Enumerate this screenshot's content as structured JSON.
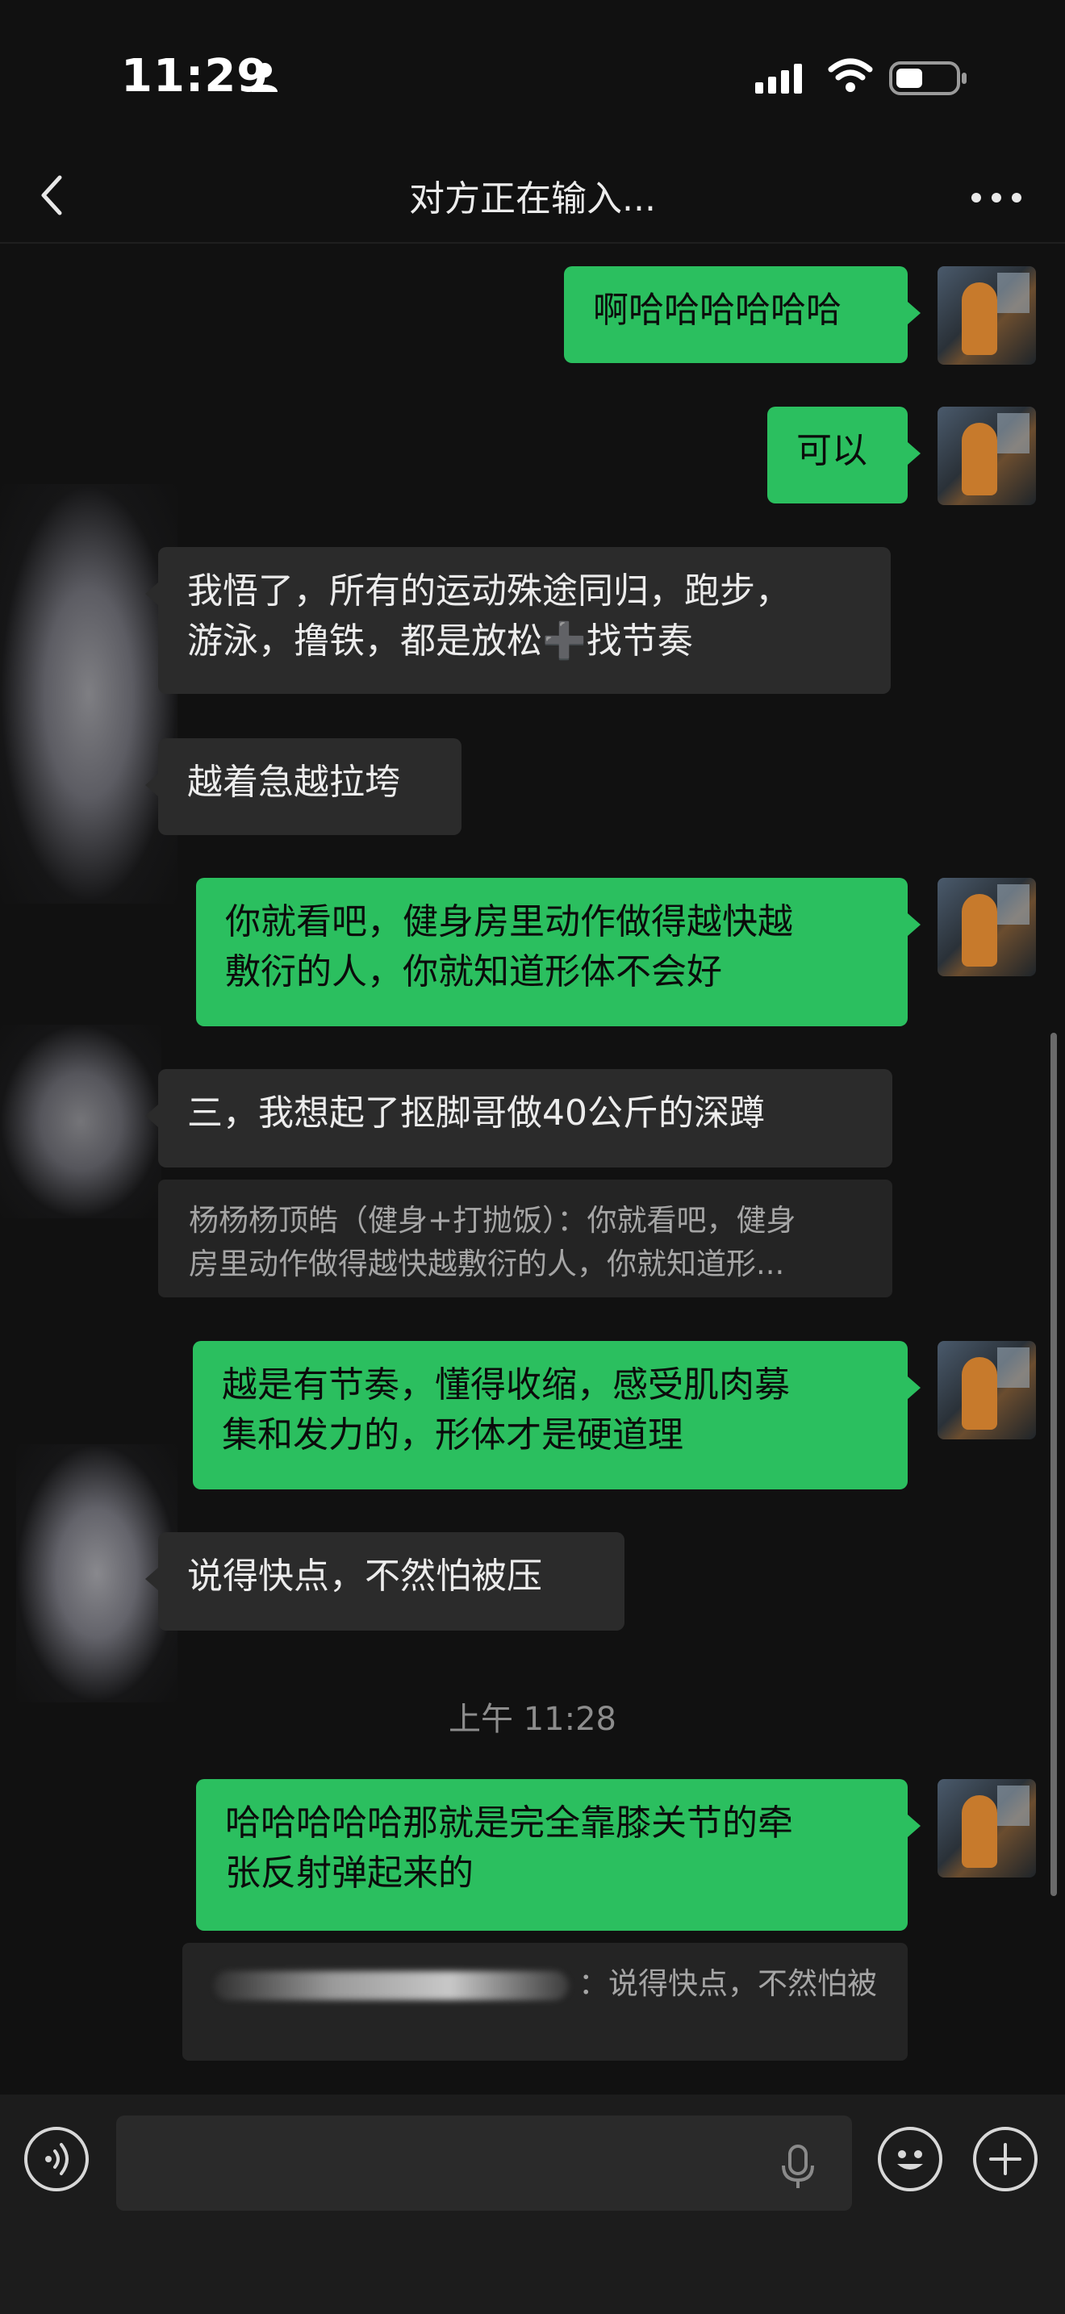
{
  "status_bar": {
    "time": "11:29"
  },
  "nav": {
    "title": "对方正在输入..."
  },
  "messages": [
    {
      "side": "out",
      "text": "啊哈哈哈哈哈哈"
    },
    {
      "side": "out",
      "text": "可以"
    },
    {
      "side": "in",
      "text": "我悟了，所有的运动殊途同归，跑步，\n游泳，撸铁，都是放松➕找节奏"
    },
    {
      "side": "in",
      "text": "越着急越拉垮"
    },
    {
      "side": "out",
      "text": "你就看吧，健身房里动作做得越快越\n敷衍的人，你就知道形体不会好"
    },
    {
      "side": "in",
      "text": "三，我想起了抠脚哥做40公斤的深蹲"
    },
    {
      "side": "quote",
      "text": "杨杨杨顶皓（健身+打抛饭）：你就看吧，健身\n房里动作做得越快越敷衍的人，你就知道形..."
    },
    {
      "side": "out",
      "text": "越是有节奏，懂得收缩，感受肌肉募\n集和发力的，形体才是硬道理"
    },
    {
      "side": "in",
      "text": "说得快点，不然怕被压"
    },
    {
      "side": "out",
      "text": "哈哈哈哈哈那就是完全靠膝关节的牵\n张反射弹起来的"
    },
    {
      "side": "quote",
      "text": "：说得快点，不然怕被"
    }
  ],
  "timestamp": "上午 11:28",
  "icons": {
    "back": "chevron-left-icon",
    "more": "more-dots-icon",
    "voice": "voice-icon",
    "mic": "mic-icon",
    "emoji": "emoji-icon",
    "plus": "plus-icon"
  }
}
